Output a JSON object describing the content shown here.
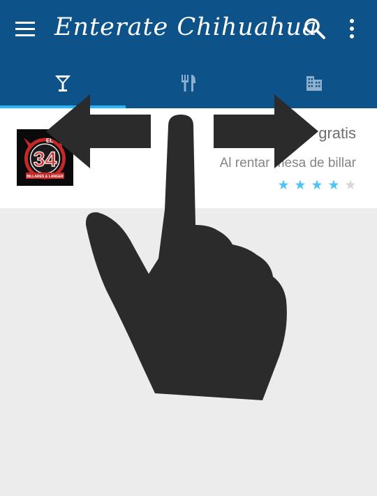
{
  "app_bar": {
    "title": "Enterate Chihuahua",
    "background_color": "#0d5288",
    "menu_icon": "menu-icon",
    "search_icon": "search-icon",
    "more_icon": "more-vert-icon"
  },
  "tabs": [
    {
      "icon": "cocktail-icon",
      "selected": true
    },
    {
      "icon": "restaurant-icon",
      "selected": false
    },
    {
      "icon": "building-icon",
      "selected": false
    }
  ],
  "listing": {
    "logo": {
      "text_el": "EL",
      "number": "34",
      "caption": "BILLARES & LANGER"
    },
    "title": "gratis",
    "description": "Al rentar mesa de billar",
    "rating": {
      "value": 4,
      "max": 5
    }
  },
  "overlay": {
    "hand_icon": "swipe-hand-icon",
    "left_arrow": "left-arrow-icon",
    "right_arrow": "right-arrow-icon"
  },
  "colors": {
    "accent": "#29b6f6",
    "star_on": "#4fc3f7",
    "star_off": "#d6d6d6",
    "overlay": "#2b2b2b"
  }
}
